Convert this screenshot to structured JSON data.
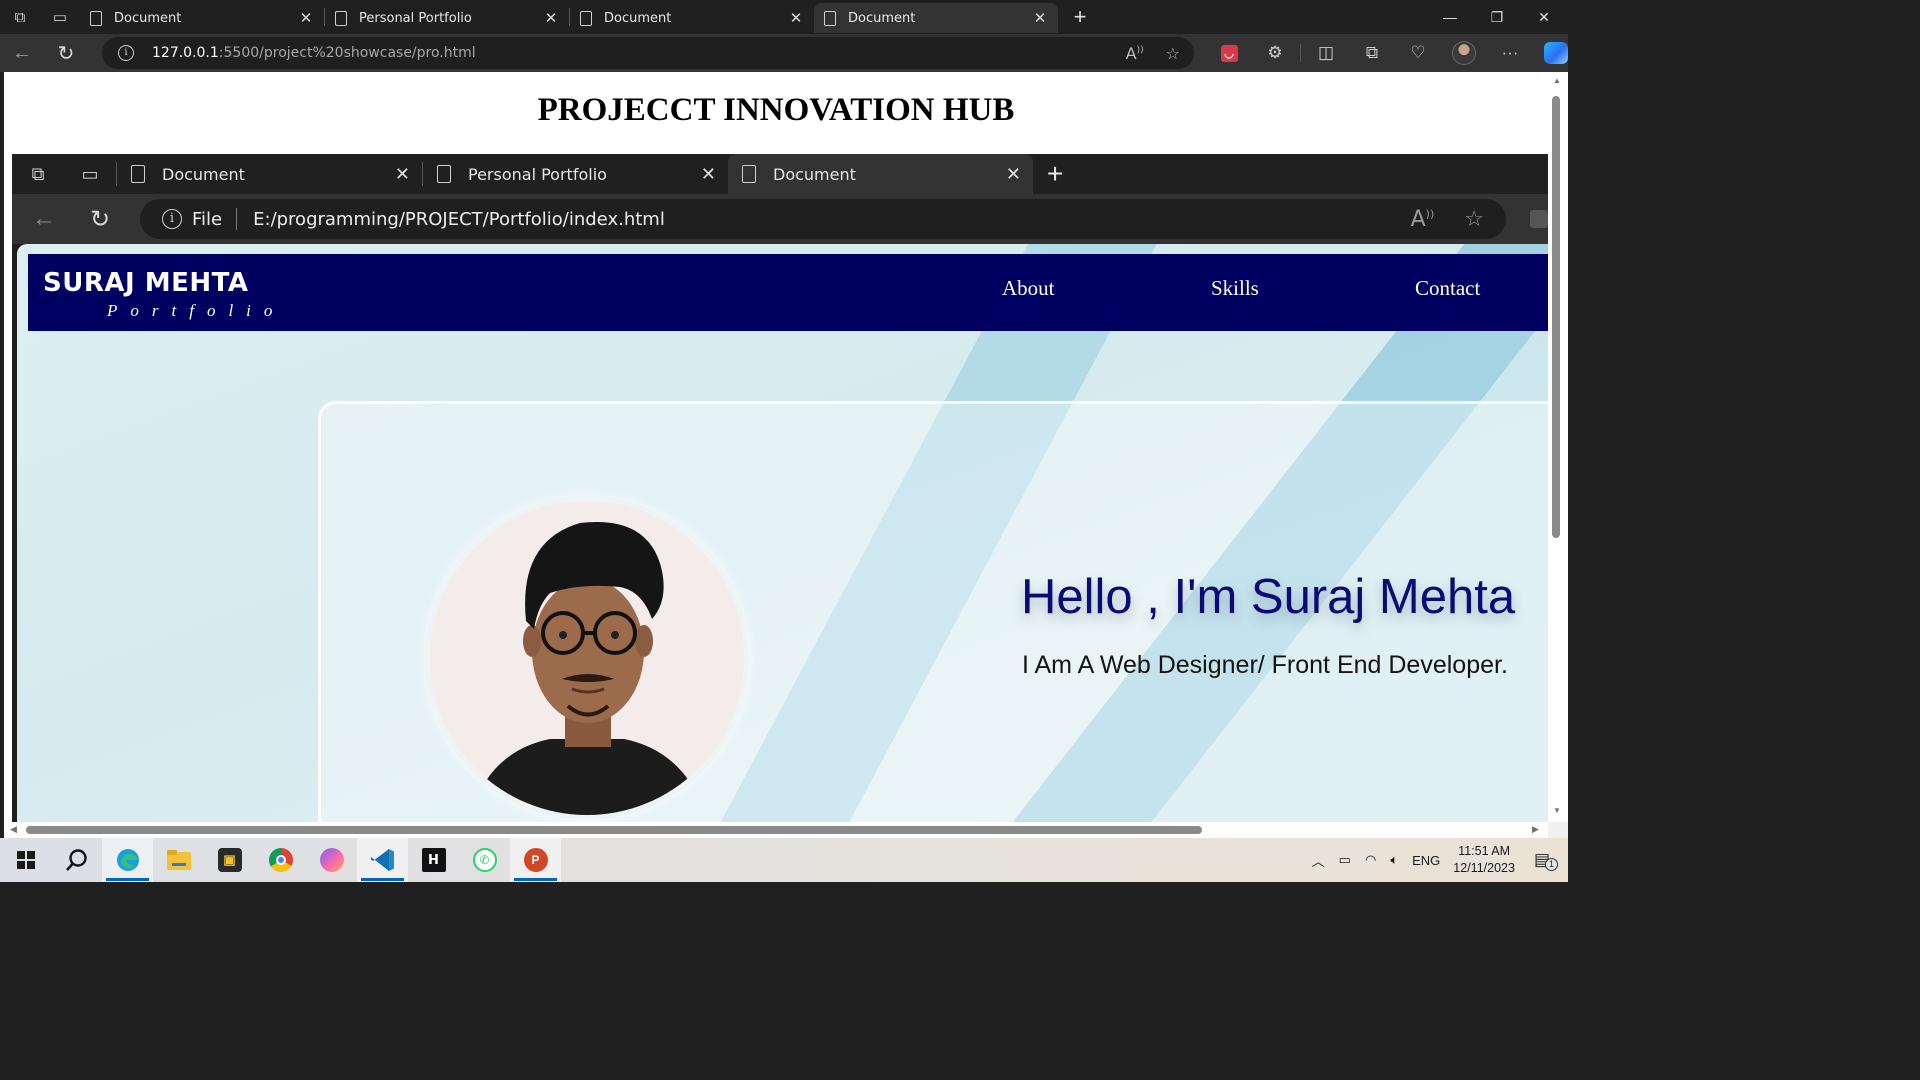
{
  "browser": {
    "tabs": [
      {
        "title": "Document",
        "active": false
      },
      {
        "title": "Personal Portfolio",
        "active": false
      },
      {
        "title": "Document",
        "active": false
      },
      {
        "title": "Document",
        "active": true
      }
    ],
    "url_host": "127.0.0.1",
    "url_path": ":5500/project%20showcase/pro.html",
    "window_controls": {
      "minimize": "—",
      "restore": "❐",
      "close": "✕"
    }
  },
  "page": {
    "title": "PROJECCT INNOVATION HUB"
  },
  "screenshot": {
    "tabs": [
      {
        "title": "Document",
        "active": false
      },
      {
        "title": "Personal Portfolio",
        "active": false
      },
      {
        "title": "Document",
        "active": true
      }
    ],
    "file_label": "File",
    "url": "E:/programming/PROJECT/Portfolio/index.html",
    "site": {
      "logo": "SURAJ MEHTA",
      "logo_sub": "Portfolio",
      "nav": [
        "About",
        "Skills",
        "Contact"
      ],
      "greeting": "Hello , I'm Suraj Mehta",
      "role": "I Am A Web Designer/ Front End Developer."
    }
  },
  "taskbar": {
    "apps": [
      "start",
      "search",
      "edge",
      "file-explorer",
      "media-player",
      "chrome",
      "affinity",
      "vscode",
      "heroku",
      "whatsapp",
      "powerpoint"
    ],
    "tray": {
      "language": "ENG",
      "time": "11:51 AM",
      "date": "12/11/2023",
      "notifications": "1"
    }
  },
  "colors": {
    "chrome_dark": "#202020",
    "chrome_mid": "#333333",
    "nav_blue": "#000060",
    "hello_blue": "#0b0b78"
  }
}
